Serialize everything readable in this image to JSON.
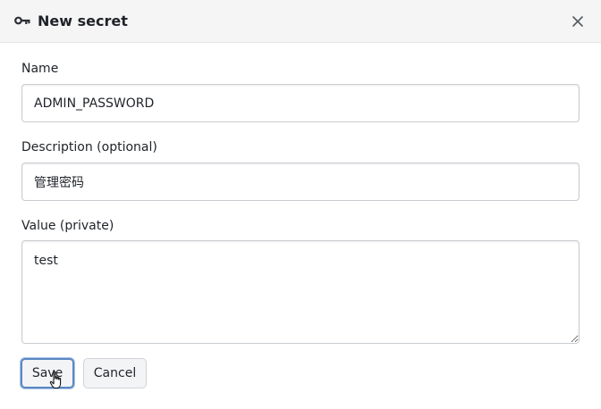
{
  "dialog": {
    "title": "New secret",
    "icon": "key-icon",
    "close_icon": "close-icon"
  },
  "form": {
    "name": {
      "label": "Name",
      "value": "ADMIN_PASSWORD"
    },
    "description": {
      "label": "Description (optional)",
      "value": "管理密码"
    },
    "secret_value": {
      "label": "Value (private)",
      "value": "test"
    }
  },
  "actions": {
    "save_label": "Save",
    "cancel_label": "Cancel"
  },
  "colors": {
    "header_bg": "#f5f5f5",
    "focus_ring": "#5a88c2",
    "border": "#c9cdd2",
    "text": "#1f2329"
  }
}
